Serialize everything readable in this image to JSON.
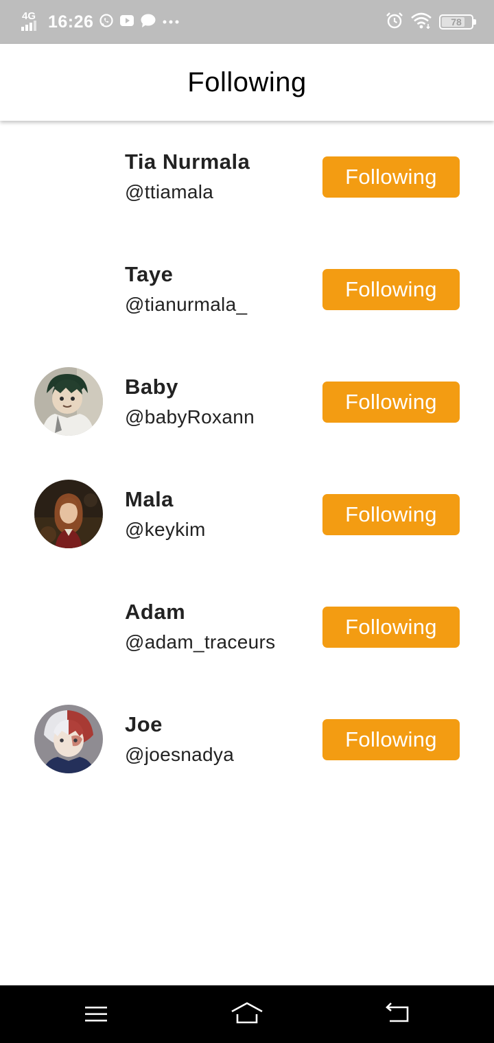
{
  "status_bar": {
    "network": "4G",
    "time": "16:26",
    "battery": "78",
    "battery_level_percent": 78,
    "left_icons": [
      "whatsapp-icon",
      "youtube-icon",
      "message-icon",
      "more-dots-icon"
    ],
    "right_icons": [
      "alarm-icon",
      "wifi-icon",
      "battery-icon"
    ]
  },
  "header": {
    "title": "Following"
  },
  "accent_color": "#f39c12",
  "users": [
    {
      "name": "Tia Nurmala",
      "handle": "@ttiamala",
      "button": "Following",
      "has_avatar": false
    },
    {
      "name": "Taye",
      "handle": "@tianurmala_",
      "button": "Following",
      "has_avatar": false
    },
    {
      "name": "Baby",
      "handle": "@babyRoxann",
      "button": "Following",
      "has_avatar": true
    },
    {
      "name": "Mala",
      "handle": "@keykim",
      "button": "Following",
      "has_avatar": true
    },
    {
      "name": "Adam",
      "handle": "@adam_traceurs",
      "button": "Following",
      "has_avatar": false
    },
    {
      "name": "Joe",
      "handle": "@joesnadya",
      "button": "Following",
      "has_avatar": true
    }
  ],
  "nav_bar": {
    "icons": [
      "menu-icon",
      "home-icon",
      "back-icon"
    ]
  }
}
